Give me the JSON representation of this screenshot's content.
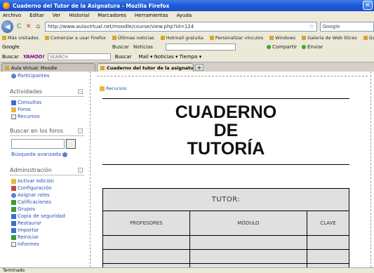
{
  "window": {
    "title": "Cuaderno del Tutor de la Asignatura - Mozilla Firefox",
    "close_glyph": "✕"
  },
  "menu": [
    "Archivo",
    "Editar",
    "Ver",
    "Historial",
    "Marcadores",
    "Herramientas",
    "Ayuda"
  ],
  "nav": {
    "back_glyph": "◀",
    "reload_glyph": "C",
    "stop_glyph": "✕",
    "home_glyph": "⌂",
    "url": "http://www.aulavirtual.net/moodle/course/view.php?id=124",
    "search_placeholder": "Google"
  },
  "bookmarks": [
    "Más visitados",
    "Comenzar a usar Firefox",
    "Últimas noticias",
    "Hotmail gratuita",
    "Personalizar vínculos",
    "Windows",
    "Galería de Web Slices",
    "Google"
  ],
  "toolbar1": {
    "brand": "Google",
    "search_label": "Buscar",
    "news_label": "Noticias",
    "item_a": "Compartir",
    "item_b": "Enviar"
  },
  "toolbar2": {
    "label": "Buscar",
    "yahoo_brand": "YAHOO!",
    "yahoo_placeholder": "SEARCH",
    "search_btn": "Buscar",
    "extras": "Mail ▾  Noticias ▾  Tiempo ▾"
  },
  "tabs": [
    {
      "label": "Aula Virtual: Moodle",
      "active": false
    },
    {
      "label": "Cuaderno del tutor de la asignatura",
      "active": true
    }
  ],
  "sidebar": {
    "top_link": "Participantes",
    "activities_title": "Actividades",
    "activities": [
      "Consultas",
      "Foros",
      "Recursos"
    ],
    "forum_search_title": "Buscar en los foros",
    "advanced_search": "Búsqueda avanzada",
    "admin_title": "Administración",
    "admin_items": [
      "Activar edición",
      "Configuración",
      "Asignar roles",
      "Calificaciones",
      "Grupos",
      "Copia de seguridad",
      "Restaurar",
      "Importar",
      "Reiniciar",
      "Informes"
    ]
  },
  "main": {
    "resources_link": "Recursos",
    "cover_line1": "CUADERNO",
    "cover_line2": "DE",
    "cover_line3": "TUTORÍA",
    "table": {
      "header": "TUTOR:",
      "columns": [
        "PROFESORES",
        "MÓDULO",
        "CLAVE"
      ]
    }
  },
  "status": "Terminado"
}
